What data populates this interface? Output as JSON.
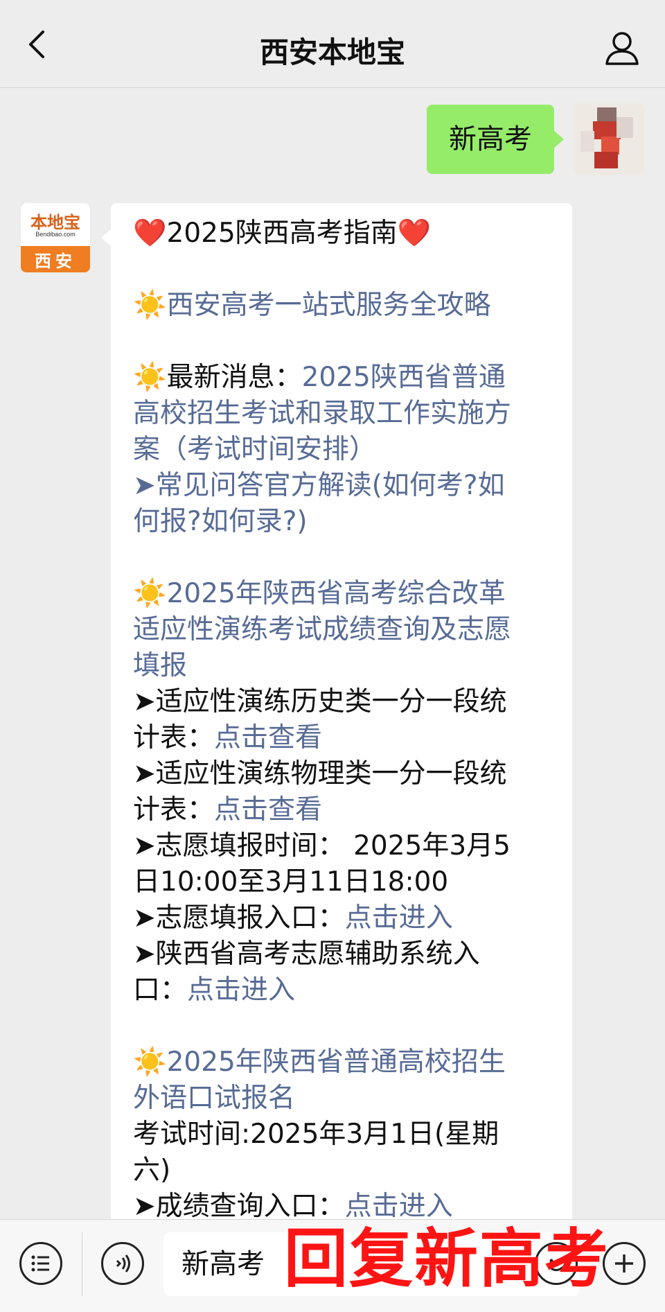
{
  "header": {
    "title": "西安本地宝"
  },
  "outgoing": {
    "text": "新高考"
  },
  "incoming_avatar": {
    "brand": "本地宝",
    "site": "Bendibao.com",
    "city": "西安"
  },
  "message": {
    "heading": "❤️2025陕西高考指南❤️",
    "s1_link": "西安高考一站式服务全攻略",
    "s2_prefix": "最新消息：",
    "s2_link_1": "2025陕西省普通",
    "s2_link_2": "高校招生考试和录取工作实施方",
    "s2_link_3": "案（考试时间安排）",
    "s2_item_1": "➤常见问答官方解读(如何考?如",
    "s2_item_2": "何报?如何录?)",
    "s3_link_1": "2025年陕西省高考综合改革",
    "s3_link_2": "适应性演练考试成绩查询及志愿",
    "s3_link_3": "填报",
    "s3_item1_1": "➤适应性演练历史类一分一段统",
    "s3_item1_2": "计表：",
    "s3_item1_link": "点击查看",
    "s3_item2_1": "➤适应性演练物理类一分一段统",
    "s3_item2_2": "计表：",
    "s3_item2_link": "点击查看",
    "s3_item3_1": "➤志愿填报时间： 2025年3月5",
    "s3_item3_2": "日10:00至3月11日18:00",
    "s3_item4": "➤志愿填报入口：",
    "s3_item4_link": "点击进入",
    "s3_item5_1": "➤陕西省高考志愿辅助系统入",
    "s3_item5_2": "口：",
    "s3_item5_link": "点击进入",
    "s4_link_1": "2025年陕西省普通高校招生",
    "s4_link_2": "外语口试报名",
    "s4_text_1": "考试时间:2025年3月1日(星期",
    "s4_text_2": "六)",
    "s4_item": "➤成绩查询入口：",
    "s4_item_link": "点击进入",
    "sun_icon": "☀️"
  },
  "inputbar": {
    "value": "新高考"
  },
  "overlay": {
    "text": "回复新高考"
  },
  "colors": {
    "link": "#576b95",
    "bubble_out": "#95ec69",
    "overlay": "#ff1414"
  }
}
